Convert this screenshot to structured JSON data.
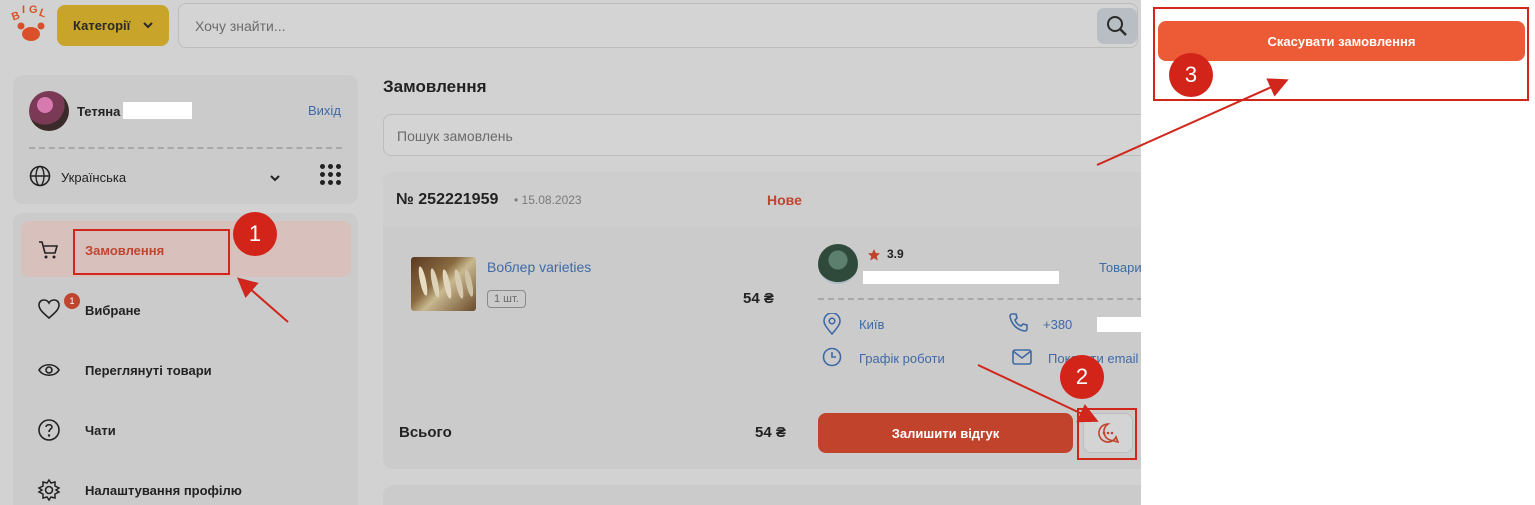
{
  "header": {
    "categories_label": "Категорії",
    "search_placeholder": "Хочу знайти..."
  },
  "profile": {
    "user_name": "Тетяна",
    "logout_label": "Вихід",
    "language": "Українська"
  },
  "nav": {
    "items": [
      {
        "label": "Замовлення",
        "icon": "cart-icon",
        "active": true
      },
      {
        "label": "Вибране",
        "icon": "heart-icon",
        "badge": "1"
      },
      {
        "label": "Переглянуті товари",
        "icon": "eye-icon"
      },
      {
        "label": "Чати",
        "icon": "help-circle-icon"
      },
      {
        "label": "Налаштування профілю",
        "icon": "gear-icon"
      }
    ]
  },
  "main": {
    "title": "Замовлення",
    "order_search_placeholder": "Пошук замовлень",
    "order": {
      "number": "№ 252221959",
      "date": "• 15.08.2023",
      "status": "Нове",
      "product_name": "Воблер varieties",
      "quantity": "1 шт.",
      "price": "54 ₴",
      "total_label": "Всього",
      "total_value": "54 ₴",
      "seller_rating": "3.9",
      "goods_link": "Товари",
      "city": "Київ",
      "schedule_link": "Графік роботи",
      "phone": "+380",
      "email_link": "Показати email",
      "review_button": "Залишити відгук"
    }
  },
  "panel": {
    "cancel_button": "Скасувати замовлення"
  },
  "annotations": {
    "step1": "1",
    "step2": "2",
    "step3": "3"
  },
  "colors": {
    "accent": "#c2432b",
    "cancel": "#ec5a36",
    "categories": "#c9a42a",
    "link": "#3f6aa6",
    "annotation": "#d3241a"
  }
}
